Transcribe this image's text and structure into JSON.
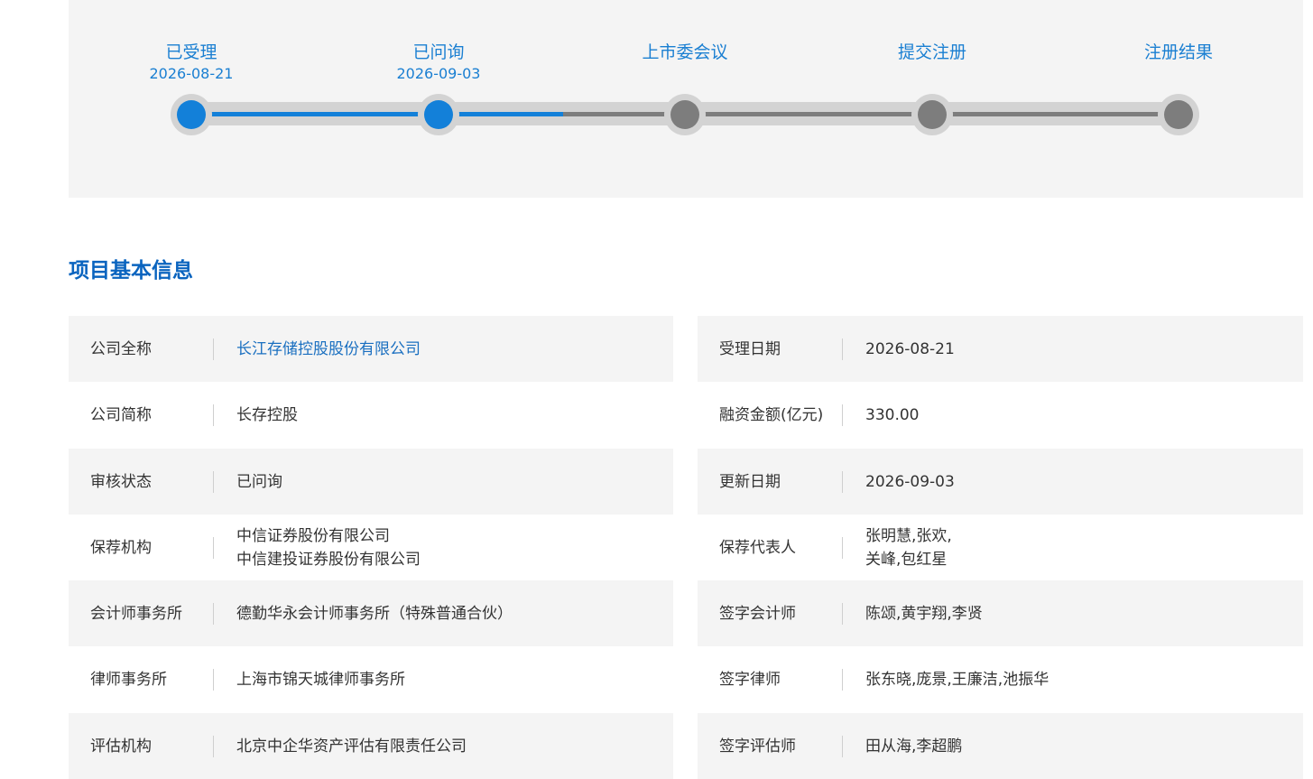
{
  "progress": {
    "steps": [
      {
        "label": "已受理",
        "date": "2026-08-21",
        "done": true
      },
      {
        "label": "已问询",
        "date": "2026-09-03",
        "done": true
      },
      {
        "label": "上市委会议",
        "date": "",
        "done": false
      },
      {
        "label": "提交注册",
        "date": "",
        "done": false
      },
      {
        "label": "注册结果",
        "date": "",
        "done": false
      }
    ],
    "active_color": "#1380d9",
    "inactive_color": "#7d7d7d"
  },
  "section": {
    "title": "项目基本信息"
  },
  "info": {
    "left": [
      {
        "label": "公司全称",
        "value": "长江存储控股股份有限公司"
      },
      {
        "label": "公司简称",
        "value": "长存控股"
      },
      {
        "label": "审核状态",
        "value": "已问询"
      },
      {
        "label": "保荐机构",
        "value_lines": [
          "中信证券股份有限公司",
          "中信建投证券股份有限公司"
        ]
      },
      {
        "label": "会计师事务所",
        "value": "德勤华永会计师事务所（特殊普通合伙）"
      },
      {
        "label": "律师事务所",
        "value": "上海市锦天城律师事务所"
      },
      {
        "label": "评估机构",
        "value": "北京中企华资产评估有限责任公司"
      }
    ],
    "right": [
      {
        "label": "受理日期",
        "value": "2026-08-21"
      },
      {
        "label": "融资金额(亿元)",
        "value": "330.00"
      },
      {
        "label": "更新日期",
        "value": "2026-09-03"
      },
      {
        "label": "保荐代表人",
        "value_lines": [
          "张明慧,张欢,",
          "关峰,包红星"
        ]
      },
      {
        "label": "签字会计师",
        "value": "陈颂,黄宇翔,李贤"
      },
      {
        "label": "签字律师",
        "value": "张东晓,庞景,王廉洁,池振华"
      },
      {
        "label": "签字评估师",
        "value": "田从海,李超鹏"
      }
    ]
  },
  "colors": {
    "title_blue": "#0a64bf",
    "link_blue": "#1a6fc0",
    "row_shade": "#f4f4f4"
  }
}
